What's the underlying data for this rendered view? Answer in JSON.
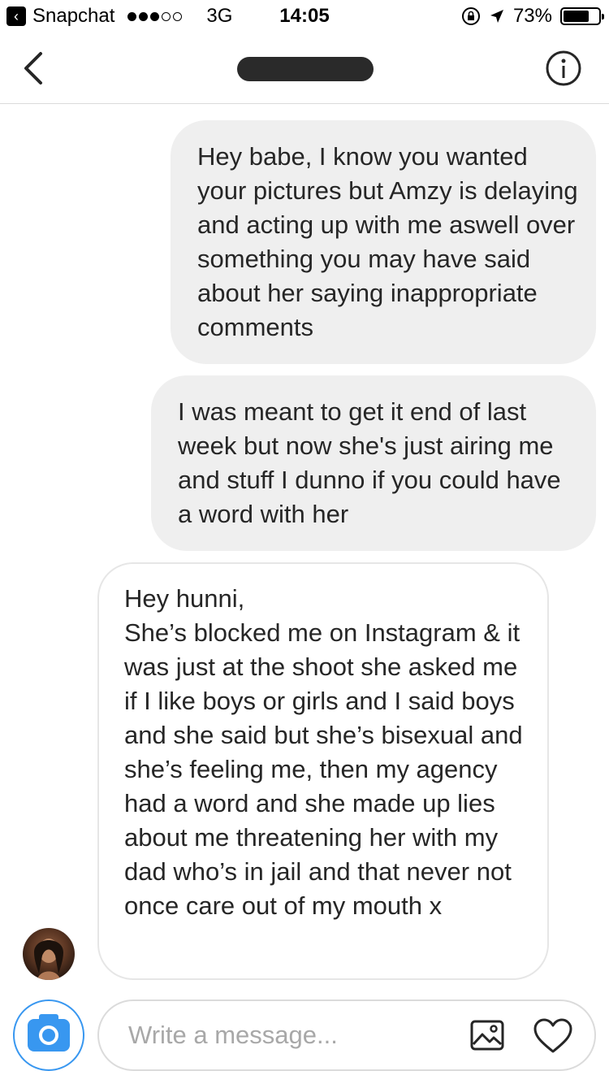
{
  "status_bar": {
    "back_app_label": "Snapchat",
    "network": "3G",
    "time": "14:05",
    "battery_text": "73%",
    "battery_level": 0.73
  },
  "header": {
    "title": "",
    "icons": {
      "back": "chevron-left-icon",
      "info": "info-icon"
    }
  },
  "messages": [
    {
      "direction": "sent",
      "text": "Hey babe, I know you wanted your pictures but Amzy is delaying and acting up with me aswell over something you may have said about her saying inappropriate comments"
    },
    {
      "direction": "sent",
      "text": "I was meant to get it end of last week but now she's just airing me and stuff I dunno if you could have a word with her"
    },
    {
      "direction": "received",
      "text": "Hey hunni,\nShe’s blocked me on Instagram & it was just at the shoot she asked me if I like boys or girls and I said boys and she said but she’s bisexual and she’s feeling me, then my agency had a word and she made up lies about me threatening her with my dad who’s in jail and that never not once care out of my mouth x"
    }
  ],
  "composer": {
    "placeholder": "Write a message...",
    "icons": {
      "camera": "camera-icon",
      "gallery": "image-icon",
      "like": "heart-icon"
    }
  },
  "colors": {
    "accent": "#3897f0",
    "sent_bubble": "#efefef",
    "border": "#dbdbdb"
  }
}
